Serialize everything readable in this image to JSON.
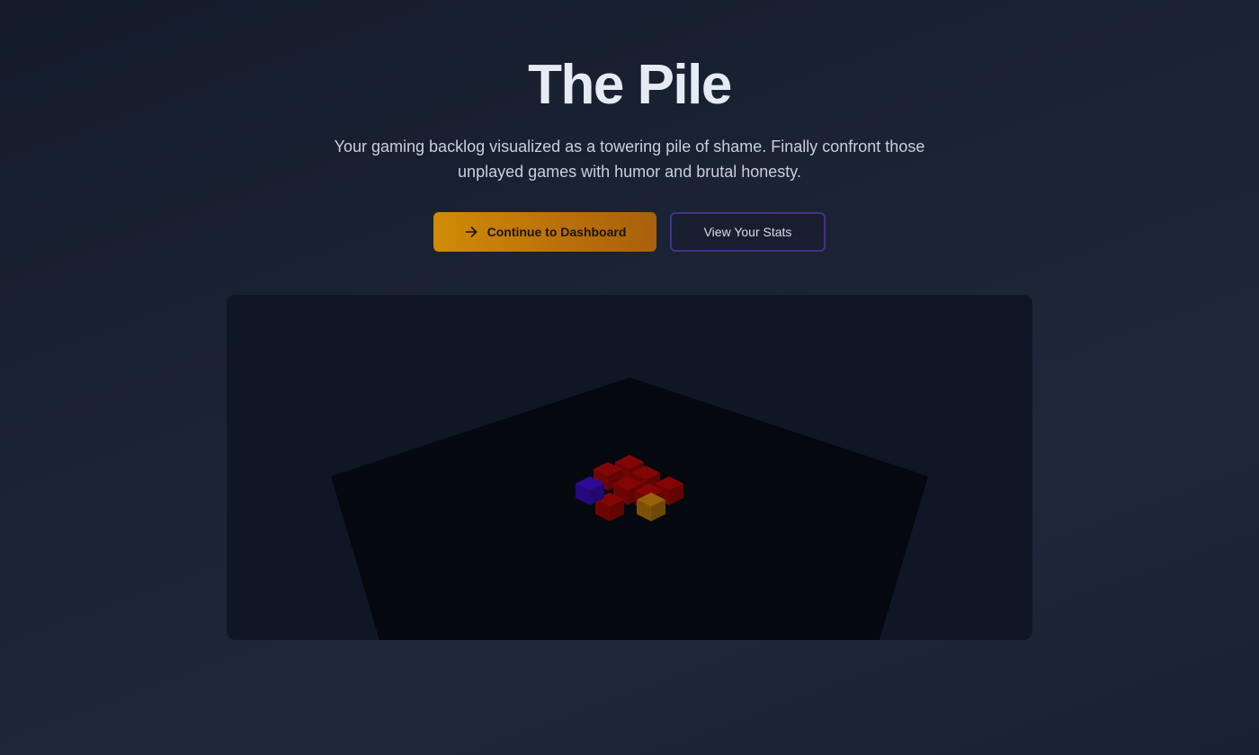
{
  "hero": {
    "title": "The Pile",
    "subtitle": "Your gaming backlog visualized as a towering pile of shame. Finally confront those unplayed games with humor and brutal honesty."
  },
  "actions": {
    "primary_label": "Continue to Dashboard",
    "primary_icon": "arrow-right-icon",
    "secondary_label": "View Your Stats"
  },
  "pile_scene": {
    "blocks": [
      {
        "color": "#7a0505"
      },
      {
        "color": "#7a0505"
      },
      {
        "color": "#7a0505"
      },
      {
        "color": "#7a0505"
      },
      {
        "color": "#7a0505"
      },
      {
        "color": "#7a0505"
      },
      {
        "color": "#7a0505"
      },
      {
        "color": "#2a0a8c"
      },
      {
        "color": "#8a5a08"
      }
    ]
  },
  "colors": {
    "accent_primary": "#d08c06",
    "accent_secondary_border": "#4a2f8a",
    "background": "#1b2435",
    "scene_background": "#0f1626",
    "floor": "#05080f"
  }
}
